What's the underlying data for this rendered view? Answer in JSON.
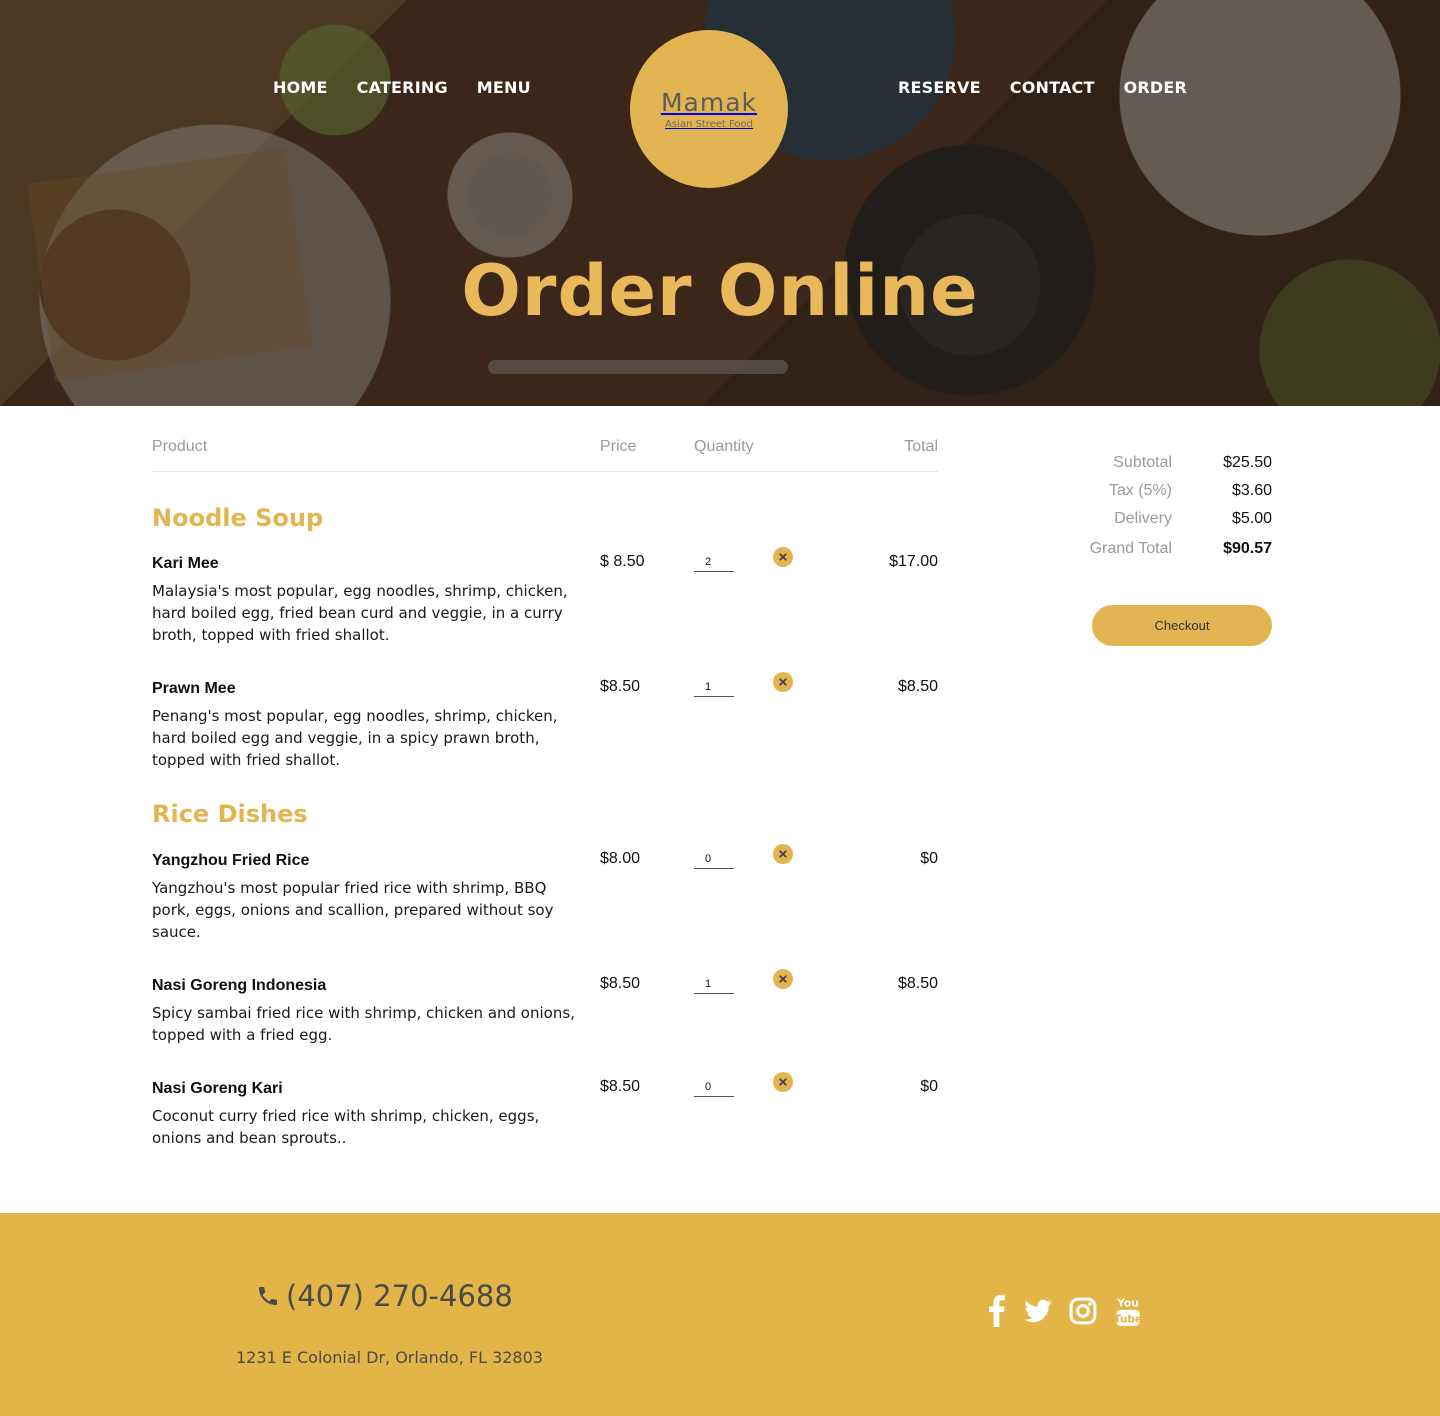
{
  "nav": {
    "left": [
      "HOME",
      "CATERING",
      "MENU"
    ],
    "right": [
      "RESERVE",
      "CONTACT",
      "ORDER"
    ]
  },
  "logo": {
    "name": "Mamak",
    "tagline": "Asian Street Food"
  },
  "hero": {
    "title": "Order Online"
  },
  "table": {
    "headers": {
      "product": "Product",
      "price": "Price",
      "quantity": "Quantity",
      "total": "Total"
    }
  },
  "categories": [
    {
      "name": "Noodle Soup",
      "items": [
        {
          "name": "Kari Mee",
          "description": "Malaysia's most popular, egg noodles, shrimp, chicken, hard boiled egg, fried bean curd and veggie, in a curry broth, topped with fried shallot.",
          "price": "$ 8.50",
          "quantity": "2",
          "total": "$17.00"
        },
        {
          "name": "Prawn Mee",
          "description": "Penang's most popular, egg noodles, shrimp, chicken, hard boiled egg and veggie, in a spicy prawn broth, topped with fried shallot.",
          "price": "$8.50",
          "quantity": "1",
          "total": "$8.50"
        }
      ]
    },
    {
      "name": "Rice Dishes",
      "items": [
        {
          "name": "Yangzhou Fried Rice",
          "description": "Yangzhou's most popular fried rice with shrimp, BBQ pork, eggs, onions and scallion, prepared without soy sauce.",
          "price": "$8.00",
          "quantity": "0",
          "total": "$0"
        },
        {
          "name": "Nasi Goreng Indonesia",
          "description": "Spicy sambai fried rice with shrimp, chicken and onions, topped with a fried egg.",
          "price": "$8.50",
          "quantity": "1",
          "total": "$8.50"
        },
        {
          "name": "Nasi Goreng Kari",
          "description": "Coconut curry fried rice with shrimp, chicken, eggs, onions and bean sprouts..",
          "price": "$8.50",
          "quantity": "0",
          "total": "$0"
        }
      ]
    }
  ],
  "summary": {
    "subtotal_label": "Subtotal",
    "subtotal": "$25.50",
    "tax_label": "Tax (5%)",
    "tax": "$3.60",
    "delivery_label": "Delivery",
    "delivery": "$5.00",
    "grand_label": "Grand Total",
    "grand": "$90.57",
    "checkout_label": "Checkout"
  },
  "footer": {
    "phone": "(407) 270-4688",
    "address": "1231 E Colonial Dr, Orlando, FL 32803",
    "social_icons": [
      "facebook-icon",
      "twitter-icon",
      "instagram-icon",
      "youtube-icon"
    ]
  },
  "colors": {
    "accent": "#e3b552",
    "footer": "#e3b548",
    "hero_title": "#e8b85a"
  }
}
